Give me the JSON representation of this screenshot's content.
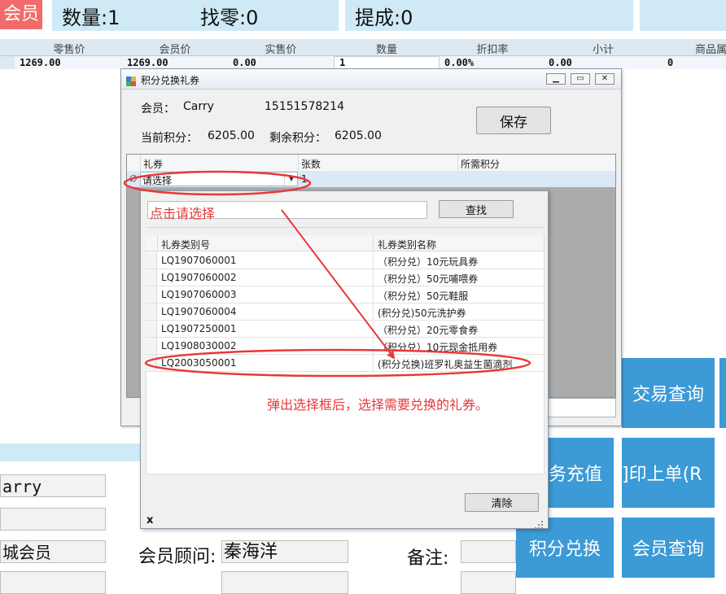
{
  "top_bar": {
    "member_label": "会员",
    "quantity_label": "数量:1",
    "change_label": "找零:0",
    "commission_label": "提成:0"
  },
  "item_table": {
    "columns": [
      "零售价",
      "会员价",
      "实售价",
      "数量",
      "折扣率",
      "小计",
      "商品属"
    ],
    "row": [
      "1269.00",
      "1269.00",
      "0.00",
      "1",
      "0.00%",
      "0.00",
      "0"
    ]
  },
  "dialog": {
    "title": "积分兑换礼券",
    "member_label": "会员：",
    "member_name": "Carry",
    "phone": "15151578214",
    "current_points_label": "当前积分：",
    "current_points": "6205.00",
    "remaining_points_label": "剩余积分：",
    "remaining_points": "6205.00",
    "save_button": "保存",
    "grid_columns": [
      "礼券",
      "张数",
      "所需积分"
    ],
    "grid_row": {
      "select_value": "请选择",
      "count": "1",
      "edit_mark": "∅"
    }
  },
  "dropdown": {
    "search_placeholder": "点击请选择",
    "search_button": "查找",
    "columns": [
      "礼券类别号",
      "礼券类别名称"
    ],
    "rows": [
      {
        "code": "LQ1907060001",
        "name": "（积分兑）10元玩具券"
      },
      {
        "code": "LQ1907060002",
        "name": "（积分兑）50元哺喂券"
      },
      {
        "code": "LQ1907060003",
        "name": "（积分兑）50元鞋服"
      },
      {
        "code": "LQ1907060004",
        "name": "(积分兑)50元洗护券"
      },
      {
        "code": "LQ1907250001",
        "name": "（积分兑）20元零食券"
      },
      {
        "code": "LQ1908030002",
        "name": "（积分兑）10元现金抵用券"
      },
      {
        "code": "LQ2003050001",
        "name": "(积分兑换)班罗礼奥益生菌滴剂"
      }
    ],
    "clear_button": "清除",
    "close_mark": "x"
  },
  "annotation": {
    "text": "弹出选择框后，选择需要兑换的礼券。",
    "color": "#e8383a"
  },
  "right_buttons": {
    "transaction_query": "交易查询",
    "recharge": "务充值",
    "print_last": "]印上单(R",
    "points_exchange": "积分兑换",
    "member_query": "会员查询"
  },
  "member_info": {
    "name_value": "arry",
    "level_value": "城会员",
    "advisor_label": "会员顾问:",
    "advisor_value": "秦海洋",
    "remark_label": "备注:"
  },
  "colors": {
    "accent_blue": "#3c9ad6",
    "panel_light": "#cfeaf6",
    "dialog_bg": "#f0f0f0",
    "member_badge": "#f26b6b"
  }
}
